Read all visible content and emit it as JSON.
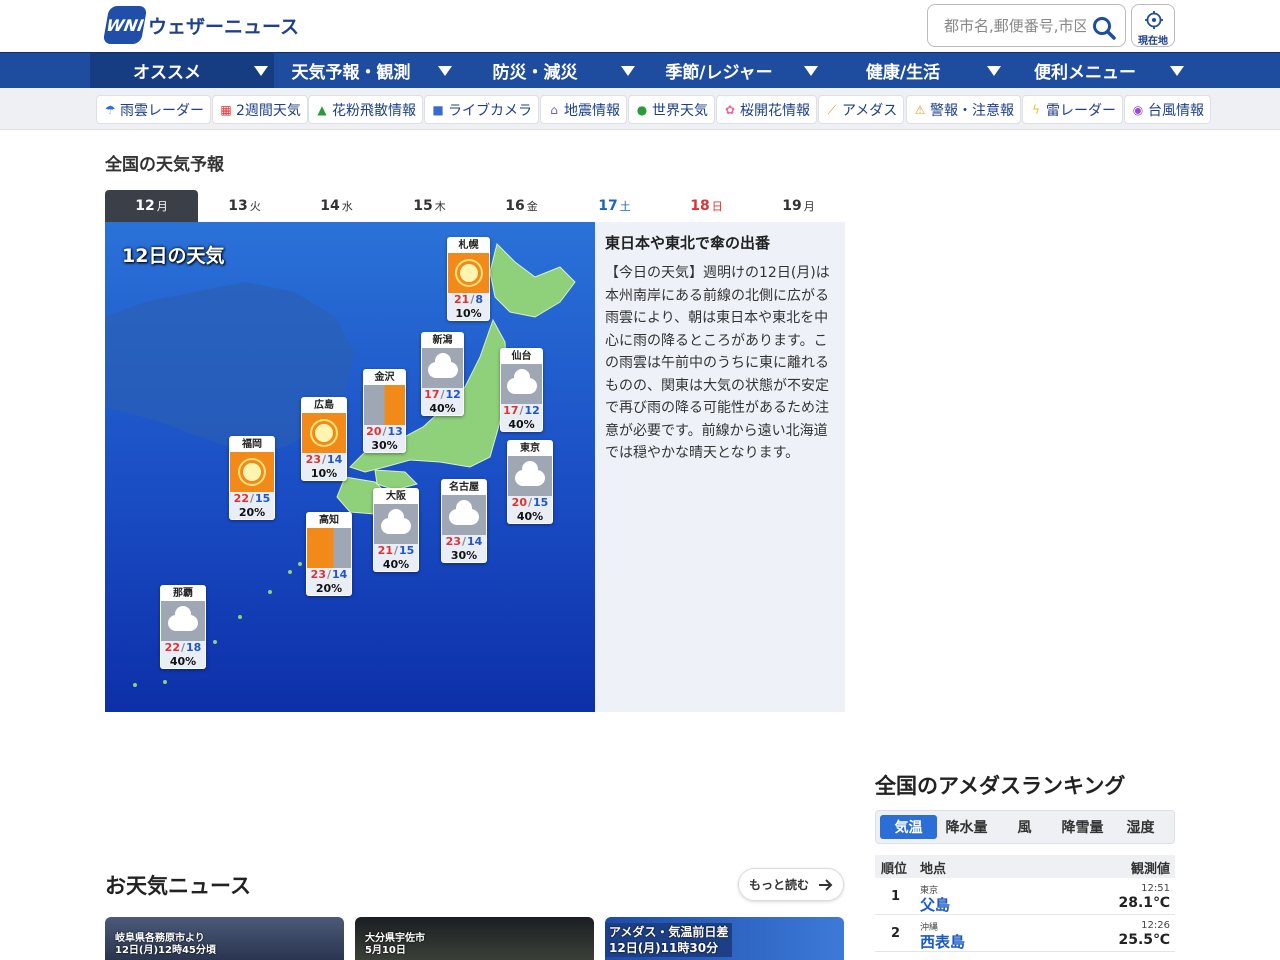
{
  "header": {
    "logo_mark": "WNI",
    "logo_text": "ウェザーニュース",
    "search_placeholder": "都市名,郵便番号,市区町村",
    "location_button": "現在地"
  },
  "main_nav": [
    {
      "label": "オススメ"
    },
    {
      "label": "天気予報・観測"
    },
    {
      "label": "防災・減災"
    },
    {
      "label": "季節/レジャー"
    },
    {
      "label": "健康/生活"
    },
    {
      "label": "便利メニュー"
    }
  ],
  "sub_nav": [
    {
      "label": "雨雲レーダー",
      "icon": "umbrella-icon"
    },
    {
      "label": "2週間天気",
      "icon": "calendar-icon"
    },
    {
      "label": "花粉飛散情報",
      "icon": "tree-icon"
    },
    {
      "label": "ライブカメラ",
      "icon": "camera-icon"
    },
    {
      "label": "地震情報",
      "icon": "house-icon"
    },
    {
      "label": "世界天気",
      "icon": "globe-icon"
    },
    {
      "label": "桜開花情報",
      "icon": "flower-icon"
    },
    {
      "label": "アメダス",
      "icon": "chart-icon"
    },
    {
      "label": "警報・注意報",
      "icon": "warning-icon"
    },
    {
      "label": "雷レーダー",
      "icon": "lightning-icon"
    },
    {
      "label": "台風情報",
      "icon": "typhoon-icon"
    }
  ],
  "forecast": {
    "section_title": "全国の天気予報",
    "tabs": [
      {
        "day": "12",
        "wd": "月"
      },
      {
        "day": "13",
        "wd": "火"
      },
      {
        "day": "14",
        "wd": "水"
      },
      {
        "day": "15",
        "wd": "木"
      },
      {
        "day": "16",
        "wd": "金"
      },
      {
        "day": "17",
        "wd": "土"
      },
      {
        "day": "18",
        "wd": "日"
      },
      {
        "day": "19",
        "wd": "月"
      }
    ],
    "map_title": "12日の天気",
    "cities": [
      {
        "name": "札幌",
        "wx": "sun",
        "hi": "21",
        "lo": "8",
        "pop": "10%"
      },
      {
        "name": "新潟",
        "wx": "cloud",
        "hi": "17",
        "lo": "12",
        "pop": "40%"
      },
      {
        "name": "仙台",
        "wx": "cloud",
        "hi": "17",
        "lo": "12",
        "pop": "40%"
      },
      {
        "name": "金沢",
        "wx": "mix",
        "hi": "20",
        "lo": "13",
        "pop": "30%"
      },
      {
        "name": "広島",
        "wx": "sun",
        "hi": "23",
        "lo": "14",
        "pop": "10%"
      },
      {
        "name": "東京",
        "wx": "cloud",
        "hi": "20",
        "lo": "15",
        "pop": "40%"
      },
      {
        "name": "福岡",
        "wx": "sun",
        "hi": "22",
        "lo": "15",
        "pop": "20%"
      },
      {
        "name": "名古屋",
        "wx": "cloud",
        "hi": "23",
        "lo": "14",
        "pop": "30%"
      },
      {
        "name": "大阪",
        "wx": "cloud",
        "hi": "21",
        "lo": "15",
        "pop": "40%"
      },
      {
        "name": "高知",
        "wx": "mix2",
        "hi": "23",
        "lo": "14",
        "pop": "20%"
      },
      {
        "name": "那覇",
        "wx": "cloud",
        "hi": "22",
        "lo": "18",
        "pop": "40%"
      }
    ],
    "news_headline": "東日本や東北で傘の出番",
    "news_body": "【今日の天気】週明けの12日(月)は本州南岸にある前線の北側に広がる雨雲により、朝は東日本や東北を中心に雨の降るところがあります。この雨雲は午前中のうちに東に離れるものの、関東は大気の状態が不安定で再び雨の降る可能性があるため注意が必要です。前線から遠い北海道では穏やかな晴天となります。"
  },
  "weather_news": {
    "title": "お天気ニュース",
    "more_label": "もっと読む",
    "thumbs": [
      {
        "caption1": "岐阜県各務原市より",
        "caption2": "12日(月)12時45分頃"
      },
      {
        "caption1": "大分県宇佐市",
        "caption2": "5月10日"
      },
      {
        "caption1": "アメダス・気温前日差",
        "caption2": "12日(月)11時30分"
      }
    ]
  },
  "ranking": {
    "title": "全国のアメダスランキング",
    "tabs": [
      "気温",
      "降水量",
      "風",
      "降雪量",
      "湿度"
    ],
    "head": {
      "rank": "順位",
      "place": "地点",
      "value": "観測値"
    },
    "rows": [
      {
        "rank": "1",
        "pref": "東京",
        "place": "父島",
        "time": "12:51",
        "value": "28.1℃"
      },
      {
        "rank": "2",
        "pref": "沖縄",
        "place": "西表島",
        "time": "12:26",
        "value": "25.5℃"
      }
    ]
  },
  "colors": {
    "brand": "#1e4c9e",
    "accent": "#2a6ed6",
    "sat": "#1a63c5",
    "sun": "#d33333"
  }
}
